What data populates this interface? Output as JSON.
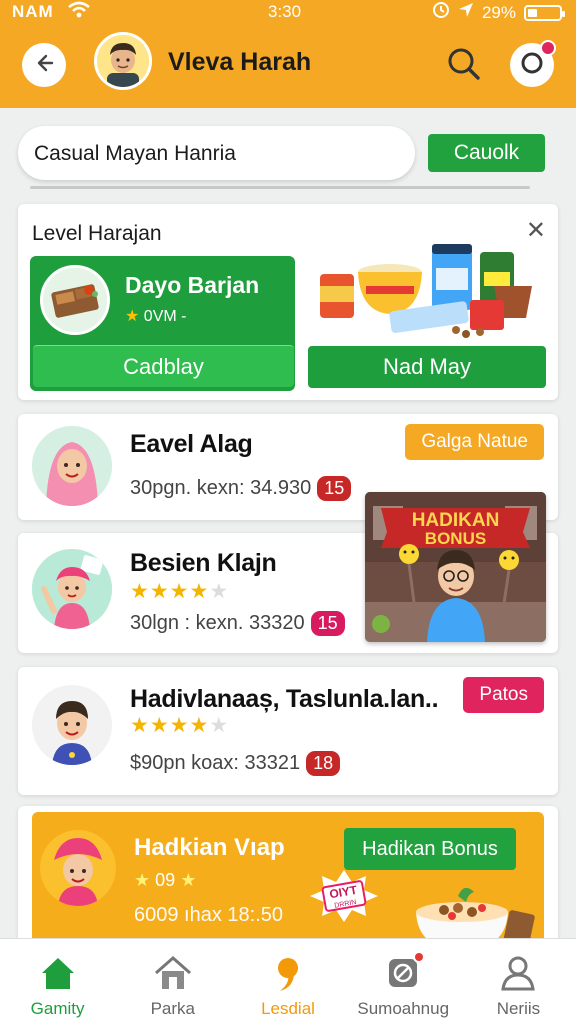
{
  "status_bar": {
    "carrier": "NAM",
    "time": "3:30",
    "battery": "29%",
    "battery_level": 0.29
  },
  "header": {
    "title": "Vleva Harah"
  },
  "search": {
    "value": "Casual Mayan Hanria",
    "action_label": "Cauolk"
  },
  "promo": {
    "title": "Level Harajan",
    "card_name": "Dayo Barjan",
    "card_sub": "0VM -",
    "left_button": "Cadblay",
    "right_button": "Nad May"
  },
  "list": [
    {
      "name": "Eavel Alag",
      "meta": "30pgn. kexn: 34.930",
      "count": "15",
      "count_color": "#c62828",
      "tag": "Galga Natue",
      "tag_color": "#f5a823",
      "rating": 0
    },
    {
      "name": "Besien Klajn",
      "meta": "30lgn : kexn. 33320",
      "count": "15",
      "count_color": "#d81b60",
      "tag": "",
      "rating": 4.5
    },
    {
      "name": "Hadivlanaaș, Taslunla.lan..",
      "meta": "$90pn koax: 33321",
      "count": "18",
      "count_color": "#c62828",
      "tag": "Patos",
      "tag_color": "#e0245e",
      "rating": 4.5
    }
  ],
  "bonus_image": {
    "title_line1": "HADIKAN",
    "title_line2": "BONUS"
  },
  "banner": {
    "name": "Hadkian Vıap",
    "stars_text": "09",
    "meta": "6009 ıhax 18:.50",
    "tag": "Hadikan Bonus",
    "sticker": "OIYT",
    "sticker_sub": "DRRIN"
  },
  "bottom_nav": [
    {
      "label": "Gamity",
      "icon": "home-icon",
      "state": "active"
    },
    {
      "label": "Parka",
      "icon": "park-icon",
      "state": "normal"
    },
    {
      "label": "Lesdial",
      "icon": "chat-bubble-icon",
      "state": "orange"
    },
    {
      "label": "Sumoahnug",
      "icon": "settings-icon",
      "state": "normal"
    },
    {
      "label": "Neriis",
      "icon": "profile-icon",
      "state": "normal"
    }
  ],
  "colors": {
    "brand_orange": "#f5a823",
    "brand_green": "#1f9e3d",
    "accent_pink": "#e0245e"
  }
}
